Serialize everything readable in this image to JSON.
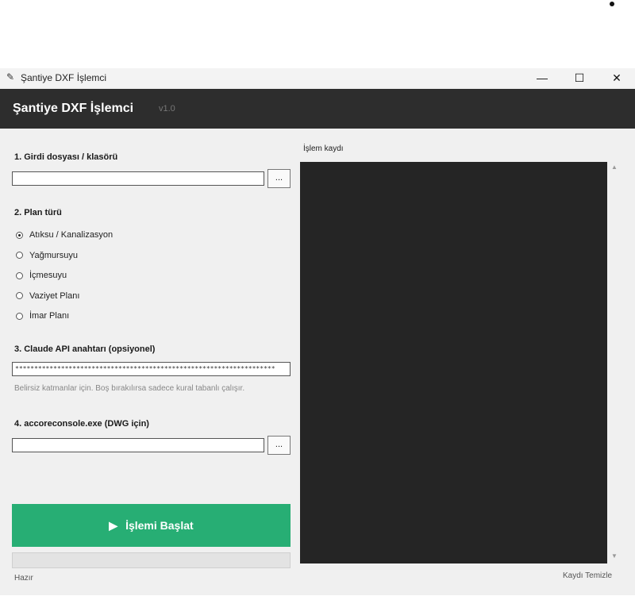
{
  "window": {
    "title": "Şantiye DXF İşlemci"
  },
  "header": {
    "title": "Şantiye DXF İşlemci",
    "version": "v1.0"
  },
  "input": {
    "label": "1. Girdi dosyası / klasörü",
    "value": "",
    "browse": "..."
  },
  "plan": {
    "label": "2. Plan türü",
    "options": [
      "Atıksu / Kanalizasyon",
      "Yağmursuyu",
      "İçmesuyu",
      "Vaziyet Planı",
      "İmar Planı"
    ],
    "selected": "Atıksu / Kanalizasyon"
  },
  "api": {
    "label": "3. Claude API anahtarı (opsiyonel)",
    "value": "********************************************************************",
    "hint": "Belirsiz katmanlar için. Boş bırakılırsa sadece kural tabanlı çalışır."
  },
  "accore": {
    "label": "4. accoreconsole.exe (DWG için)",
    "value": "",
    "browse": "..."
  },
  "start_button": {
    "icon": "▶",
    "label": "İşlemi Başlat"
  },
  "progress": {
    "value": 0
  },
  "status": "Hazır",
  "log": {
    "label": "İşlem kaydı",
    "clear": "Kaydı Temizle"
  },
  "icons": {
    "app": "feather-icon",
    "radio": "radio-icon"
  },
  "colors": {
    "accent": "#27ae74",
    "header": "#2d2d2d",
    "log_bg": "#252525"
  }
}
